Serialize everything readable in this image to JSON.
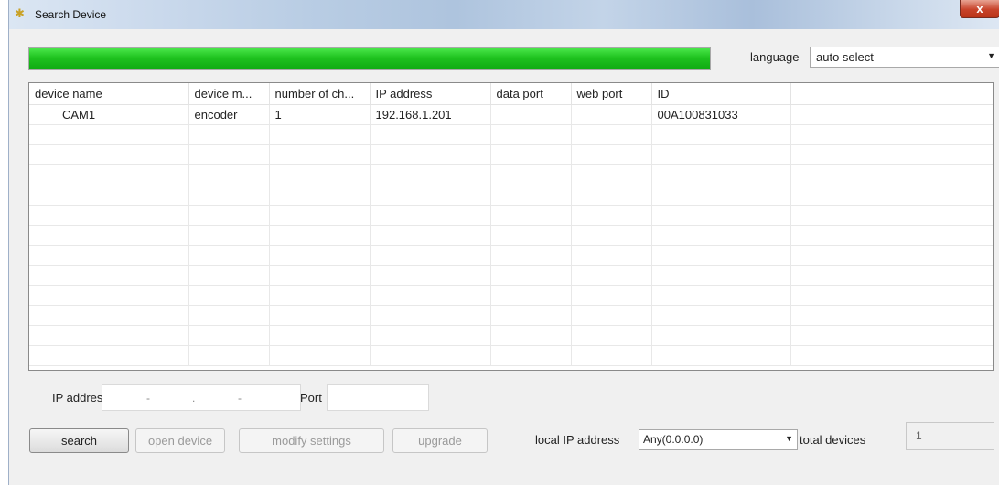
{
  "window": {
    "title": "Search Device",
    "close_glyph": "x"
  },
  "progress": {
    "value_percent": 100,
    "color": "#1fc21f"
  },
  "language": {
    "label": "language",
    "selected": "auto select"
  },
  "table": {
    "columns": [
      "device name",
      "device m...",
      "number of ch...",
      "IP address",
      "data port",
      "web port",
      "ID",
      ""
    ],
    "rows": [
      [
        "CAM1",
        "encoder",
        "1",
        "192.168.1.201",
        "",
        "",
        "00A100831033",
        ""
      ]
    ]
  },
  "ip_form": {
    "ip_label": "IP address",
    "ip_separators": [
      "-",
      ".",
      "-"
    ],
    "port_label": "Port",
    "port_value": ""
  },
  "buttons": {
    "search": "search",
    "open_device": "open device",
    "modify_settings": "modify settings",
    "upgrade": "upgrade"
  },
  "local_ip": {
    "label": "local IP address",
    "selected": "Any(0.0.0.0)"
  },
  "total": {
    "label": "total devices",
    "value": "1"
  }
}
